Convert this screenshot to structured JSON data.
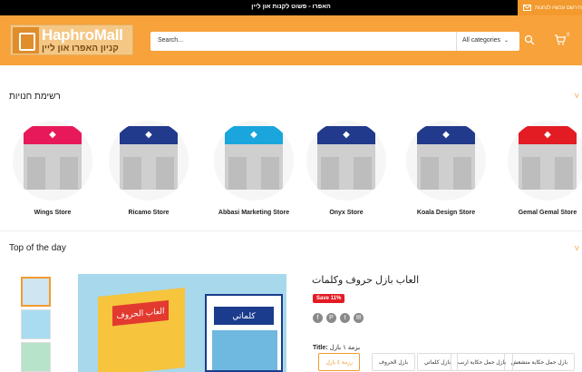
{
  "topbar": {
    "promo": "האפרו - פשוט לקנות און ליין",
    "signup": "הירשם עכשיו לנחנות"
  },
  "header": {
    "logo_name": "HaphroMall",
    "logo_tagline": "קניון האפרו און ליין",
    "search_placeholder": "Search...",
    "category_select": "All categories",
    "cart_count": "0"
  },
  "stores_section": {
    "title": "רשימת חנויות",
    "view_all": "V",
    "stores": [
      {
        "name": "Wings Store",
        "sign_color": "#e7195a"
      },
      {
        "name": "Ricamo Store",
        "sign_color": "#213a8c"
      },
      {
        "name": "Abbasi Marketing Store",
        "sign_color": "#1aa6dc"
      },
      {
        "name": "Onyx Store",
        "sign_color": "#213a8c"
      },
      {
        "name": "Koala Design Store",
        "sign_color": "#213a8c"
      },
      {
        "name": "Gemal Gemal Store",
        "sign_color": "#e31b23"
      }
    ]
  },
  "top_day": {
    "title": "Top of the day",
    "view_all": "V",
    "product": {
      "title": "العاب بازل حروف وكلمات",
      "badge": "Save 11%",
      "box1_label": "العاب الحروف",
      "box2_label": "كلماتي",
      "share_icons": [
        "facebook-icon",
        "pinterest-icon",
        "twitter-icon",
        "email-icon"
      ],
      "option_label": "Title:",
      "option_value": "بزمة ١ بازل",
      "options": [
        {
          "label": "بازل حمل حكاية متشعش",
          "selected": false
        },
        {
          "label": "بازل حمل حكاية ارنب",
          "selected": false
        },
        {
          "label": "بازل كلماتي",
          "selected": false
        },
        {
          "label": "بازل الحروف",
          "selected": false
        },
        {
          "label": "رزمة ٤ بازل",
          "selected": true
        }
      ]
    }
  },
  "colors": {
    "accent": "#f39a2e",
    "header": "#f7a23a",
    "sale": "#e31b23"
  }
}
